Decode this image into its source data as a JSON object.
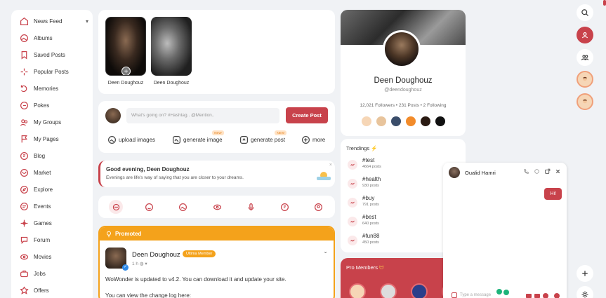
{
  "sidebar": {
    "items": [
      {
        "label": "News Feed",
        "icon": "home-icon"
      },
      {
        "label": "Albums",
        "icon": "album-icon"
      },
      {
        "label": "Saved Posts",
        "icon": "bookmark-icon"
      },
      {
        "label": "Popular Posts",
        "icon": "sparkle-icon"
      },
      {
        "label": "Memories",
        "icon": "memories-icon"
      },
      {
        "label": "Pokes",
        "icon": "poke-icon"
      },
      {
        "label": "My Groups",
        "icon": "groups-icon"
      },
      {
        "label": "My Pages",
        "icon": "flag-icon"
      },
      {
        "label": "Blog",
        "icon": "blog-icon"
      },
      {
        "label": "Market",
        "icon": "market-icon"
      },
      {
        "label": "Explore",
        "icon": "compass-icon"
      },
      {
        "label": "Events",
        "icon": "events-icon"
      },
      {
        "label": "Games",
        "icon": "games-icon"
      },
      {
        "label": "Forum",
        "icon": "forum-icon"
      },
      {
        "label": "Movies",
        "icon": "movies-icon"
      },
      {
        "label": "Jobs",
        "icon": "jobs-icon"
      },
      {
        "label": "Offers",
        "icon": "offers-icon"
      }
    ]
  },
  "stories": [
    {
      "name": "Deen Doughouz"
    },
    {
      "name": "Deen Doughouz"
    }
  ],
  "composer": {
    "placeholder": "What's going on? #Hashtag.. @Mention..",
    "post_button": "Create Post",
    "tools": [
      {
        "label": "upload images",
        "icon": "image-upload-icon"
      },
      {
        "label": "generate image",
        "icon": "ai-image-icon",
        "badge": "NEW"
      },
      {
        "label": "generate post",
        "icon": "ai-post-icon",
        "badge": "NEW"
      },
      {
        "label": "more",
        "icon": "plus-circle-icon"
      }
    ]
  },
  "greeting": {
    "title": "Good evening, Deen Doughouz",
    "subtitle": "Evenings are life's way of saying that you are closer to your dreams.",
    "close": "×"
  },
  "post": {
    "promoted_label": "Promoted",
    "author": "Deen Doughouz",
    "badge": "Ultima Member",
    "time": "1 h",
    "text1": "WoWonder is updated to v4.2. You can download it and update your site.",
    "text2": "You can view the change log here:"
  },
  "profile": {
    "name": "Deen Doughouz",
    "handle": "@deendoughouz",
    "stats": "12,021 Followers • 231 Posts • 2 Following"
  },
  "trendings": {
    "title": "Trendings",
    "items": [
      {
        "tag": "#test",
        "count": "4664 posts"
      },
      {
        "tag": "#health",
        "count": "930 posts"
      },
      {
        "tag": "#buy",
        "count": "791 posts"
      },
      {
        "tag": "#best",
        "count": "640 posts"
      },
      {
        "tag": "#fun88",
        "count": "450 posts"
      }
    ]
  },
  "pro_members": {
    "title": "Pro Members"
  },
  "chat": {
    "name": "Oualid Hamri",
    "message": "Hi!",
    "input_placeholder": "Type a message"
  },
  "colors": {
    "accent": "#c8424b",
    "promoted": "#f4a21b",
    "background": "#f0f2f5"
  }
}
